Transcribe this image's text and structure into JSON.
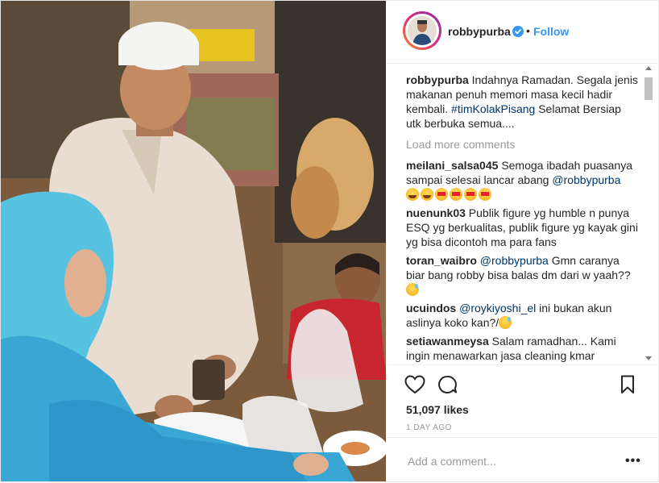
{
  "post": {
    "username": "robbypurba",
    "follow_label": "Follow",
    "separator": "•",
    "avatar_icon": "profile-avatar"
  },
  "caption": {
    "user": "robbypurba",
    "text_before": "Indahnya Ramadan. Segala jenis makanan penuh memori masa kecil hadir kembali.",
    "hashtag": "#timKolakPisang",
    "text_after": "Selamat Bersiap utk berbuka semua...."
  },
  "load_more_label": "Load more comments",
  "comments": [
    {
      "user": "meilani_salsa045",
      "text": "Semoga ibadah puasanya sampai selesai lancar abang",
      "mention": "@robbypurba"
    },
    {
      "user": "nuenunk03",
      "text": "Publik figure yg humble n punya ESQ yg berkualitas, publik figure yg kayak gini yg bisa dicontoh ma para fans"
    },
    {
      "user": "toran_waibro",
      "mention": "@robbypurba",
      "text": "Gmn caranya biar bang robby bisa balas dm dari w yaah??"
    },
    {
      "user": "ucuindos",
      "mention": "@roykiyoshi_el",
      "text": "ini bukan akun aslinya koko kan?/"
    },
    {
      "user": "setiawanmeysa",
      "text": "Salam ramadhan... Kami ingin menawarkan jasa cleaning kmar"
    }
  ],
  "actions": {
    "like_icon": "heart-icon",
    "comment_icon": "comment-icon",
    "save_icon": "bookmark-icon"
  },
  "likes_text": "51,097 likes",
  "timestamp": "1 DAY AGO",
  "add_comment_placeholder": "Add a comment...",
  "more_label": "•••",
  "colors": {
    "link": "#3897f0",
    "mention": "#003569",
    "muted": "#999999",
    "text": "#262626"
  }
}
